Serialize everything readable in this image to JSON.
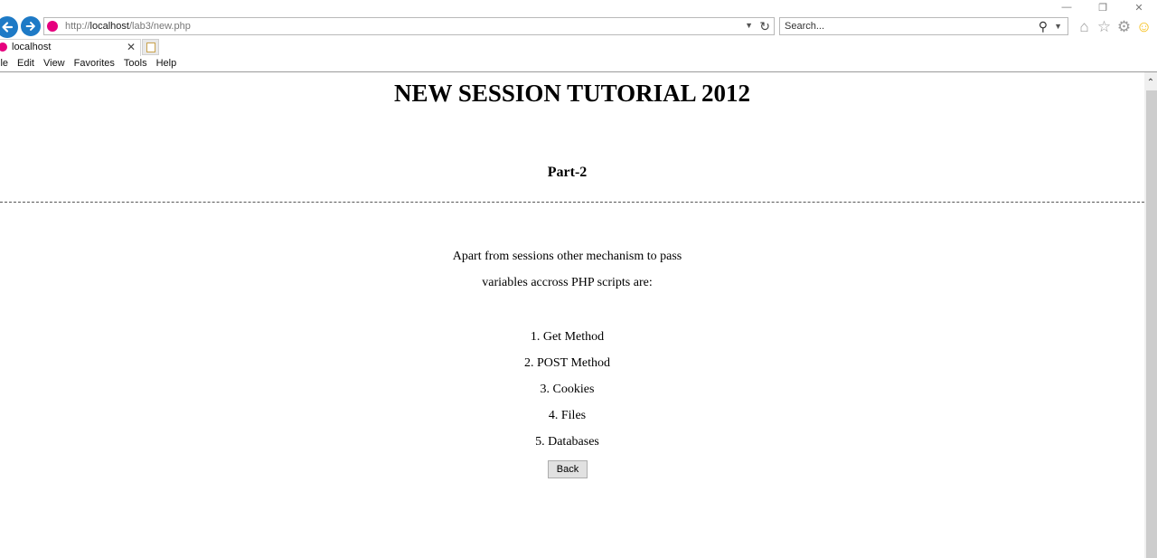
{
  "browser": {
    "address_url_scheme": "http://",
    "address_url_host": "localhost",
    "address_url_path": "/lab3/new.php",
    "search_placeholder": "Search...",
    "tab_title": "localhost",
    "menu": [
      "ile",
      "Edit",
      "View",
      "Favorites",
      "Tools",
      "Help"
    ],
    "icons": {
      "minimize": "minimize-icon",
      "restore": "restore-icon",
      "close": "close-icon",
      "back": "back-arrow-icon",
      "forward": "forward-arrow-icon",
      "refresh": "refresh-icon",
      "search": "search-icon",
      "home": "home-icon",
      "favorites": "star-icon",
      "tools": "gear-icon",
      "feedback": "smiley-icon"
    },
    "colors": {
      "nav_blue": "#1e7ac6",
      "site_icon": "#e6007e",
      "smiley": "#f5b800"
    }
  },
  "page": {
    "heading": "NEW SESSION TUTORIAL 2012",
    "subheading": "Part-2",
    "intro_lines": [
      "Apart from sessions other mechanism to pass",
      "variables accross PHP scripts are:"
    ],
    "list_items": [
      "1. Get Method",
      "2. POST Method",
      "3. Cookies",
      "4. Files",
      "5. Databases"
    ],
    "back_button": "Back"
  }
}
